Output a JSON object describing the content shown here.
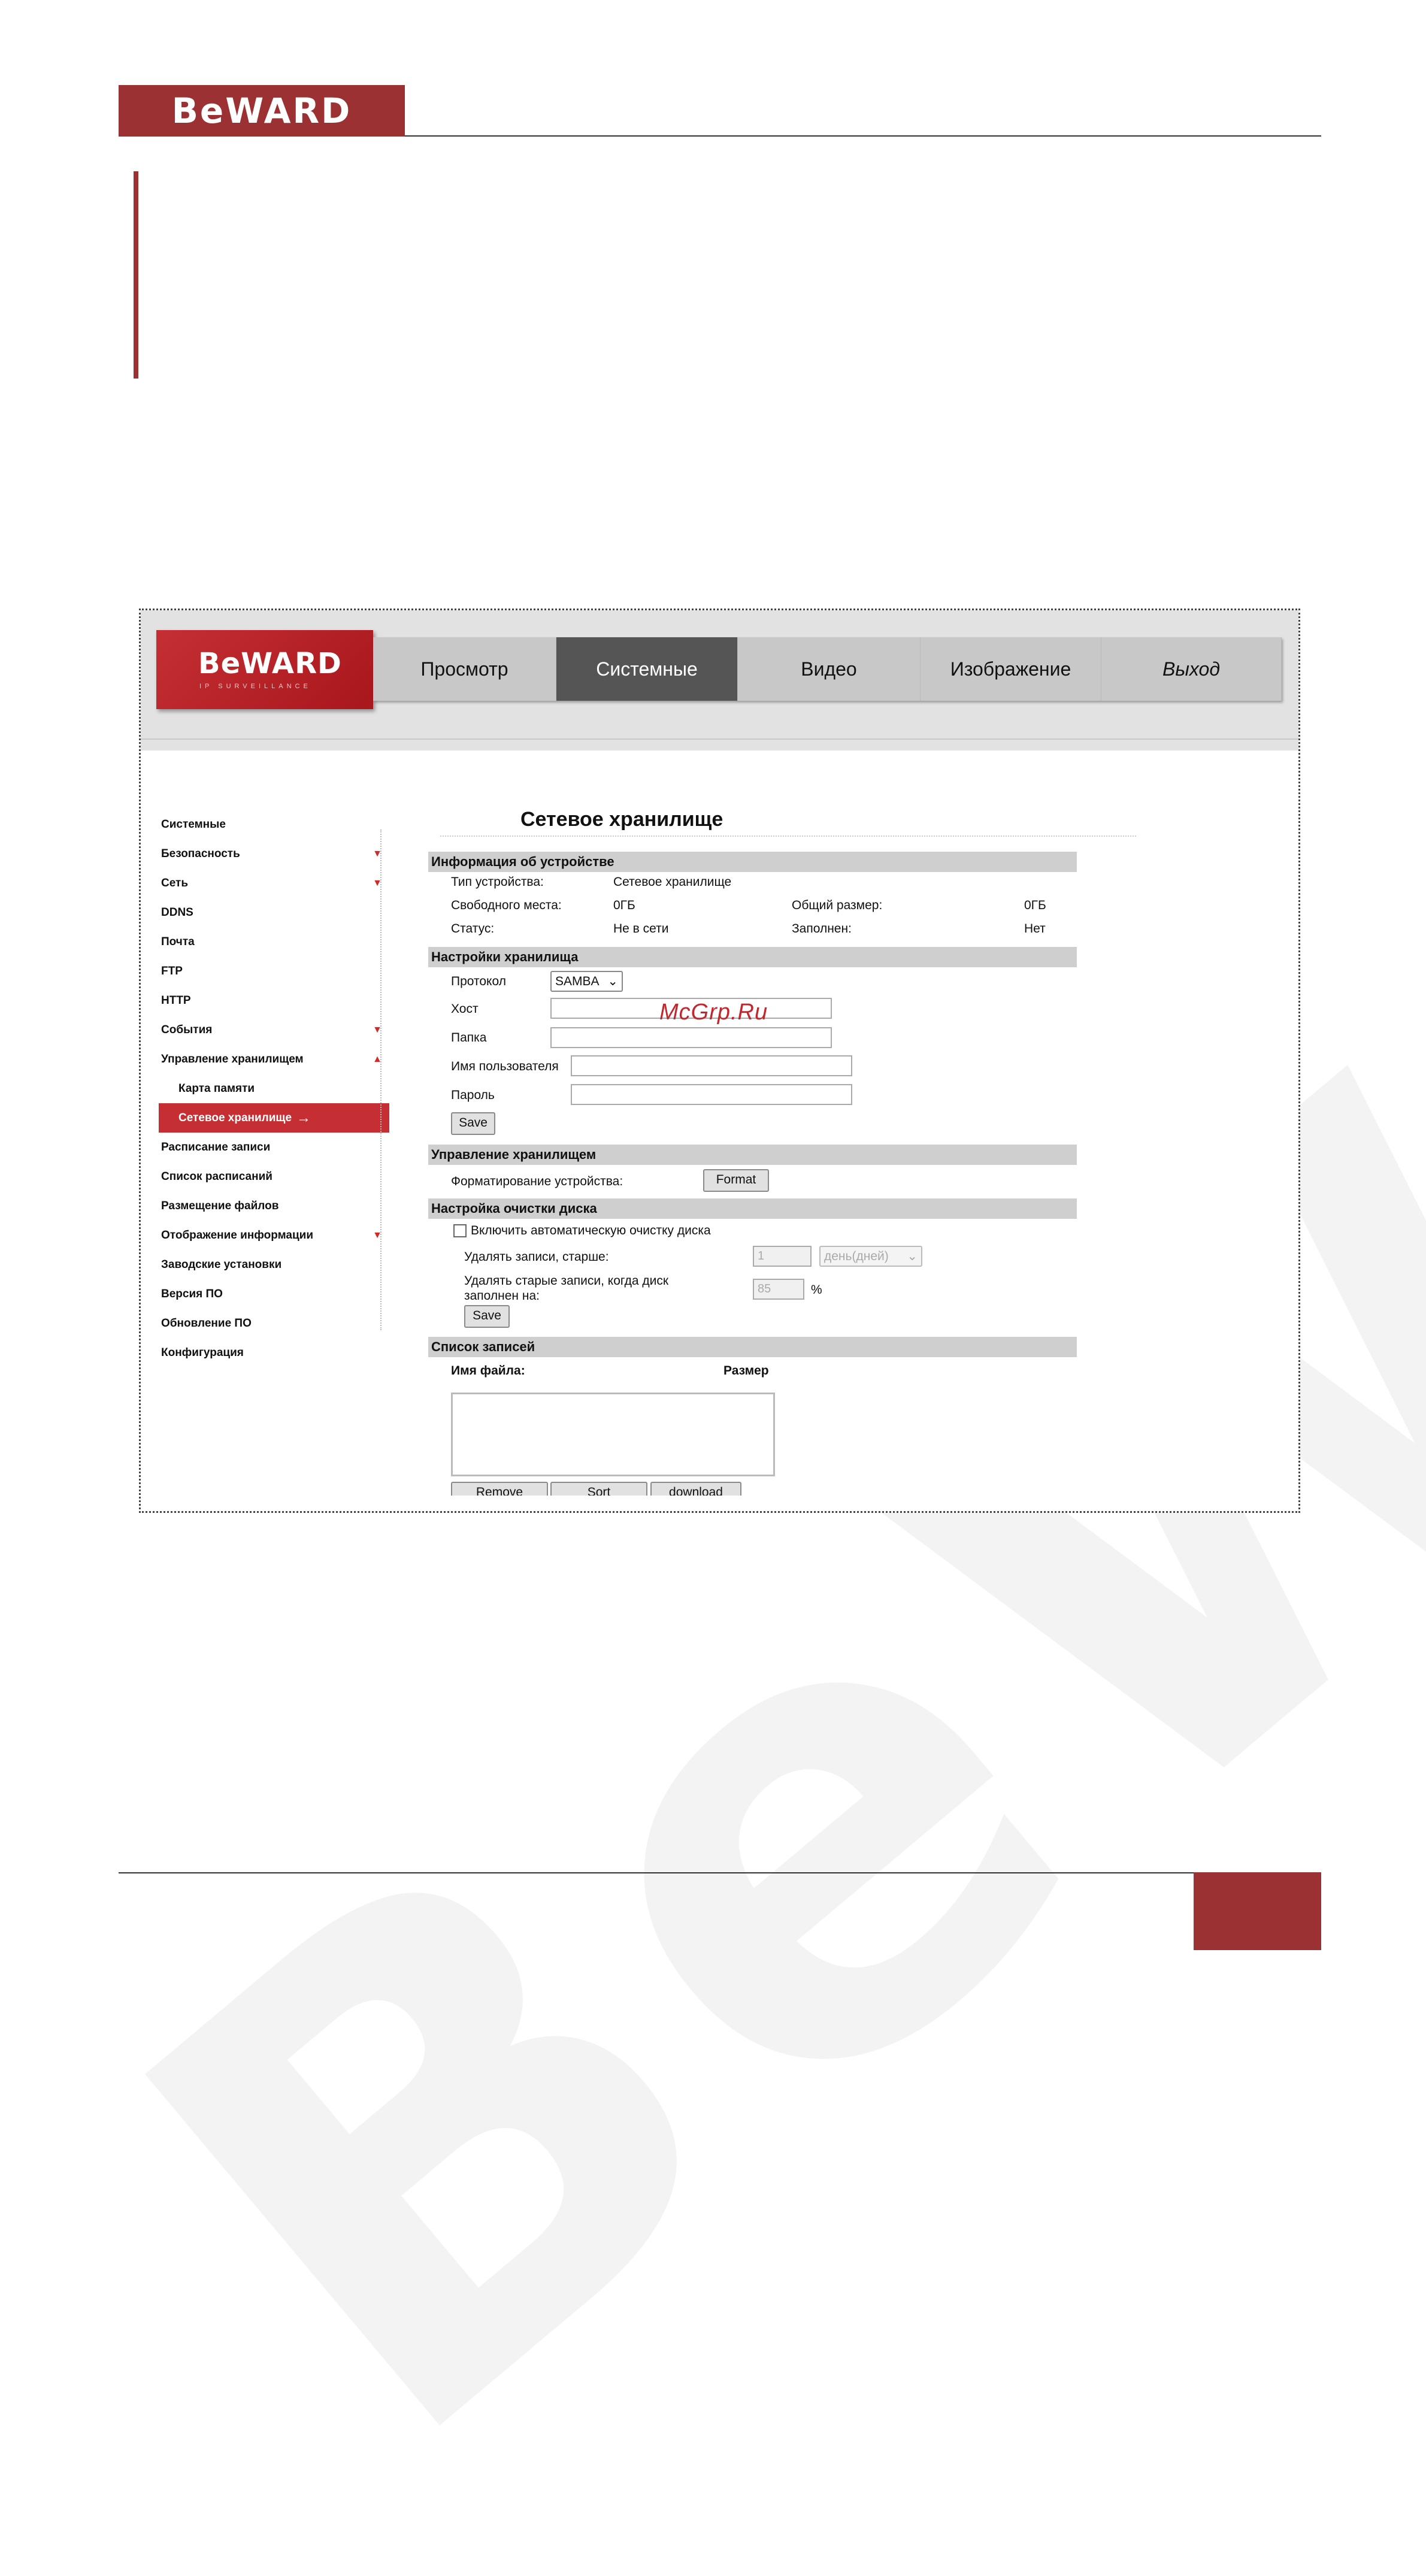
{
  "page": {
    "logo_text": "BeWARD",
    "watermark_text": "BeWARD"
  },
  "app": {
    "logo": {
      "name": "BeWARD",
      "subtitle": "IP SURVEILLANCE"
    },
    "tabs": [
      {
        "label": "Просмотр",
        "active": false
      },
      {
        "label": "Системные",
        "active": true
      },
      {
        "label": "Видео",
        "active": false
      },
      {
        "label": "Изображение",
        "active": false
      },
      {
        "label": "Выход",
        "active": false
      }
    ],
    "menu": [
      {
        "label": "Системные"
      },
      {
        "label": "Безопасность",
        "arrow": "▼"
      },
      {
        "label": "Сеть",
        "arrow": "▼"
      },
      {
        "label": "DDNS"
      },
      {
        "label": "Почта"
      },
      {
        "label": "FTP"
      },
      {
        "label": "HTTP"
      },
      {
        "label": "События",
        "arrow": "▼"
      },
      {
        "label": "Управление хранилищем",
        "arrow": "▲"
      },
      {
        "label": "Карта памяти",
        "sub": true
      },
      {
        "label": "Сетевое хранилище",
        "sub": true,
        "active": true,
        "right_arrow": "→"
      },
      {
        "label": "Расписание записи"
      },
      {
        "label": "Список расписаний"
      },
      {
        "label": "Размещение файлов"
      },
      {
        "label": "Отображение информации",
        "arrow": "▼"
      },
      {
        "label": "Заводские установки"
      },
      {
        "label": "Версия ПО"
      },
      {
        "label": "Обновление ПО"
      },
      {
        "label": "Конфигурация"
      }
    ],
    "title": "Сетевое хранилище",
    "device_info": {
      "header": "Информация об устройстве",
      "type_label": "Тип устройства:",
      "type_value": "Сетевое хранилище",
      "free_label": "Свободного места:",
      "free_value": "0ГБ",
      "total_label": "Общий размер:",
      "total_value": "0ГБ",
      "status_label": "Статус:",
      "status_value": "Не в сети",
      "full_label": "Заполнен:",
      "full_value": "Нет"
    },
    "storage_settings": {
      "header": "Настройки хранилища",
      "protocol_label": "Протокол",
      "protocol_value": "SAMBA",
      "host_label": "Хост",
      "folder_label": "Папка",
      "user_label": "Имя пользователя",
      "password_label": "Пароль",
      "save": "Save"
    },
    "storage_management": {
      "header": "Управление хранилищем",
      "format_label": "Форматирование устройства:",
      "format_button": "Format"
    },
    "disk_cleanup": {
      "header": "Настройка очистки диска",
      "enable_label": "Включить автоматическую очистку диска",
      "delete_older_label": "Удалять записи, старше:",
      "delete_older_value": "1",
      "unit_value": "день(дней)",
      "delete_full_label_1": "Удалять старые записи, когда диск",
      "delete_full_label_2": "заполнен на:",
      "delete_full_value": "85",
      "percent": "%",
      "save": "Save"
    },
    "records": {
      "header": "Список записей",
      "col_name": "Имя файла:",
      "col_size": "Размер",
      "remove": "Remove",
      "sort": "Sort",
      "download": "download"
    },
    "site_watermark": "McGrp.Ru"
  }
}
